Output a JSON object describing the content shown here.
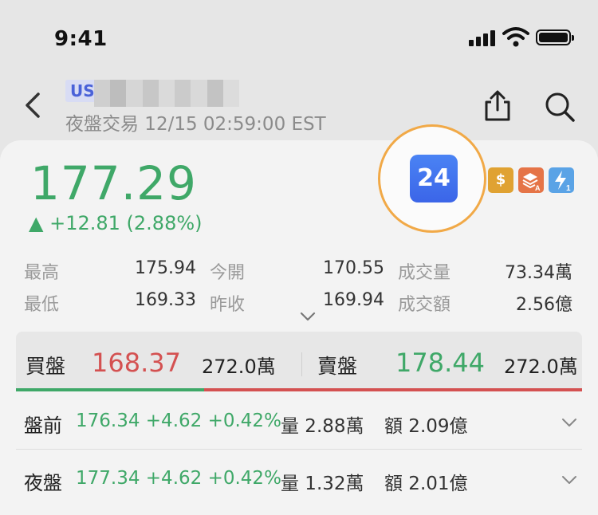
{
  "status_bar": {
    "time": "9:41"
  },
  "header": {
    "market_tag": "US",
    "subtitle": "夜盤交易 12/15 02:59:00 EST"
  },
  "quote": {
    "price": "177.29",
    "change": "▲ +12.81 (2.88%)",
    "badge_24": "24",
    "mini_icons": [
      "dollar-icon",
      "layers-a-icon",
      "flash-1-icon"
    ],
    "colors": {
      "up": "#3fa868",
      "down": "#d45151",
      "accent": "#3b65e8",
      "highlight_ring": "#f1a947"
    }
  },
  "stats": [
    {
      "label": "最高",
      "value": "175.94"
    },
    {
      "label": "今開",
      "value": "170.55"
    },
    {
      "label": "成交量",
      "value": "73.34萬"
    },
    {
      "label": "最低",
      "value": "169.33"
    },
    {
      "label": "昨收",
      "value": "169.94"
    },
    {
      "label": "成交額",
      "value": "2.56億"
    }
  ],
  "bid_ask": {
    "bid_label": "買盤",
    "bid_price": "168.37",
    "bid_volume": "272.0萬",
    "ask_label": "賣盤",
    "ask_price": "178.44",
    "ask_volume": "272.0萬"
  },
  "sessions": [
    {
      "label": "盤前",
      "quote": "176.34 +4.62 +0.42%",
      "volume": "量 2.88萬",
      "amount": "額 2.09億"
    },
    {
      "label": "夜盤",
      "quote": "177.34 +4.62 +0.42%",
      "volume": "量 1.32萬",
      "amount": "額 2.01億"
    }
  ]
}
